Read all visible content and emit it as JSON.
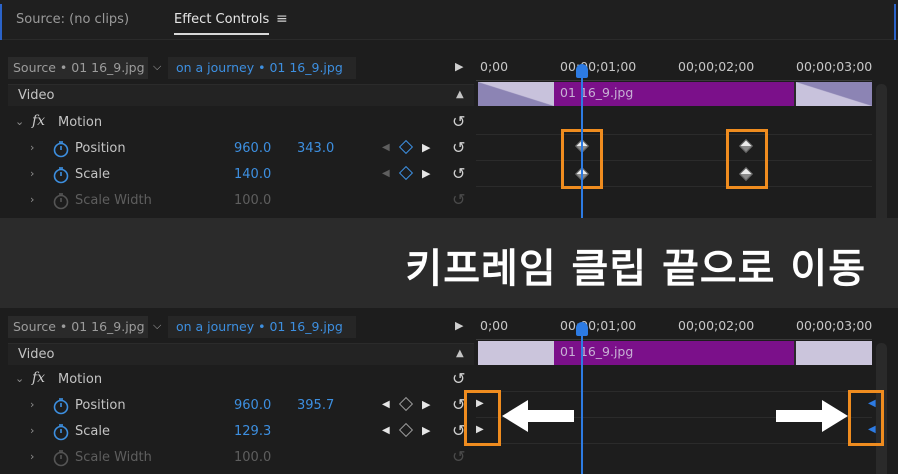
{
  "tabs": [
    {
      "label": "Source: (no clips)"
    },
    {
      "label": "Effect Controls"
    }
  ],
  "tab_menu_icon": "≡",
  "banner": {
    "text": "키프레임 클립 끝으로 이동"
  },
  "colors": {
    "accent_blue": "#2d7be3",
    "clip_purple": "#7b108a",
    "highlight_orange": "#ef8c1f"
  },
  "panels": [
    {
      "source_label": "Source • 01 16_9.jpg",
      "sequence_label": "on a journey • 01 16_9.jpg",
      "video_label": "Video",
      "motion_label": "Motion",
      "properties": [
        {
          "name": "Position",
          "value1": "960.0",
          "value2": "343.0"
        },
        {
          "name": "Scale",
          "value1": "140.0",
          "value2": ""
        },
        {
          "name": "Scale Width",
          "value1": "100.0",
          "value2": ""
        }
      ],
      "ruler": [
        "0;00",
        "00;00;01;00",
        "00;00;02;00",
        "00;00;03;00"
      ],
      "clip_name": "01 16_9.jpg"
    },
    {
      "source_label": "Source • 01 16_9.jpg",
      "sequence_label": "on a journey • 01 16_9.jpg",
      "video_label": "Video",
      "motion_label": "Motion",
      "properties": [
        {
          "name": "Position",
          "value1": "960.0",
          "value2": "395.7"
        },
        {
          "name": "Scale",
          "value1": "129.3",
          "value2": ""
        },
        {
          "name": "Scale Width",
          "value1": "100.0",
          "value2": ""
        }
      ],
      "ruler": [
        "0;00",
        "00;00;01;00",
        "00;00;02;00",
        "00;00;03;00"
      ],
      "clip_name": "01 16_9.jpg"
    }
  ]
}
